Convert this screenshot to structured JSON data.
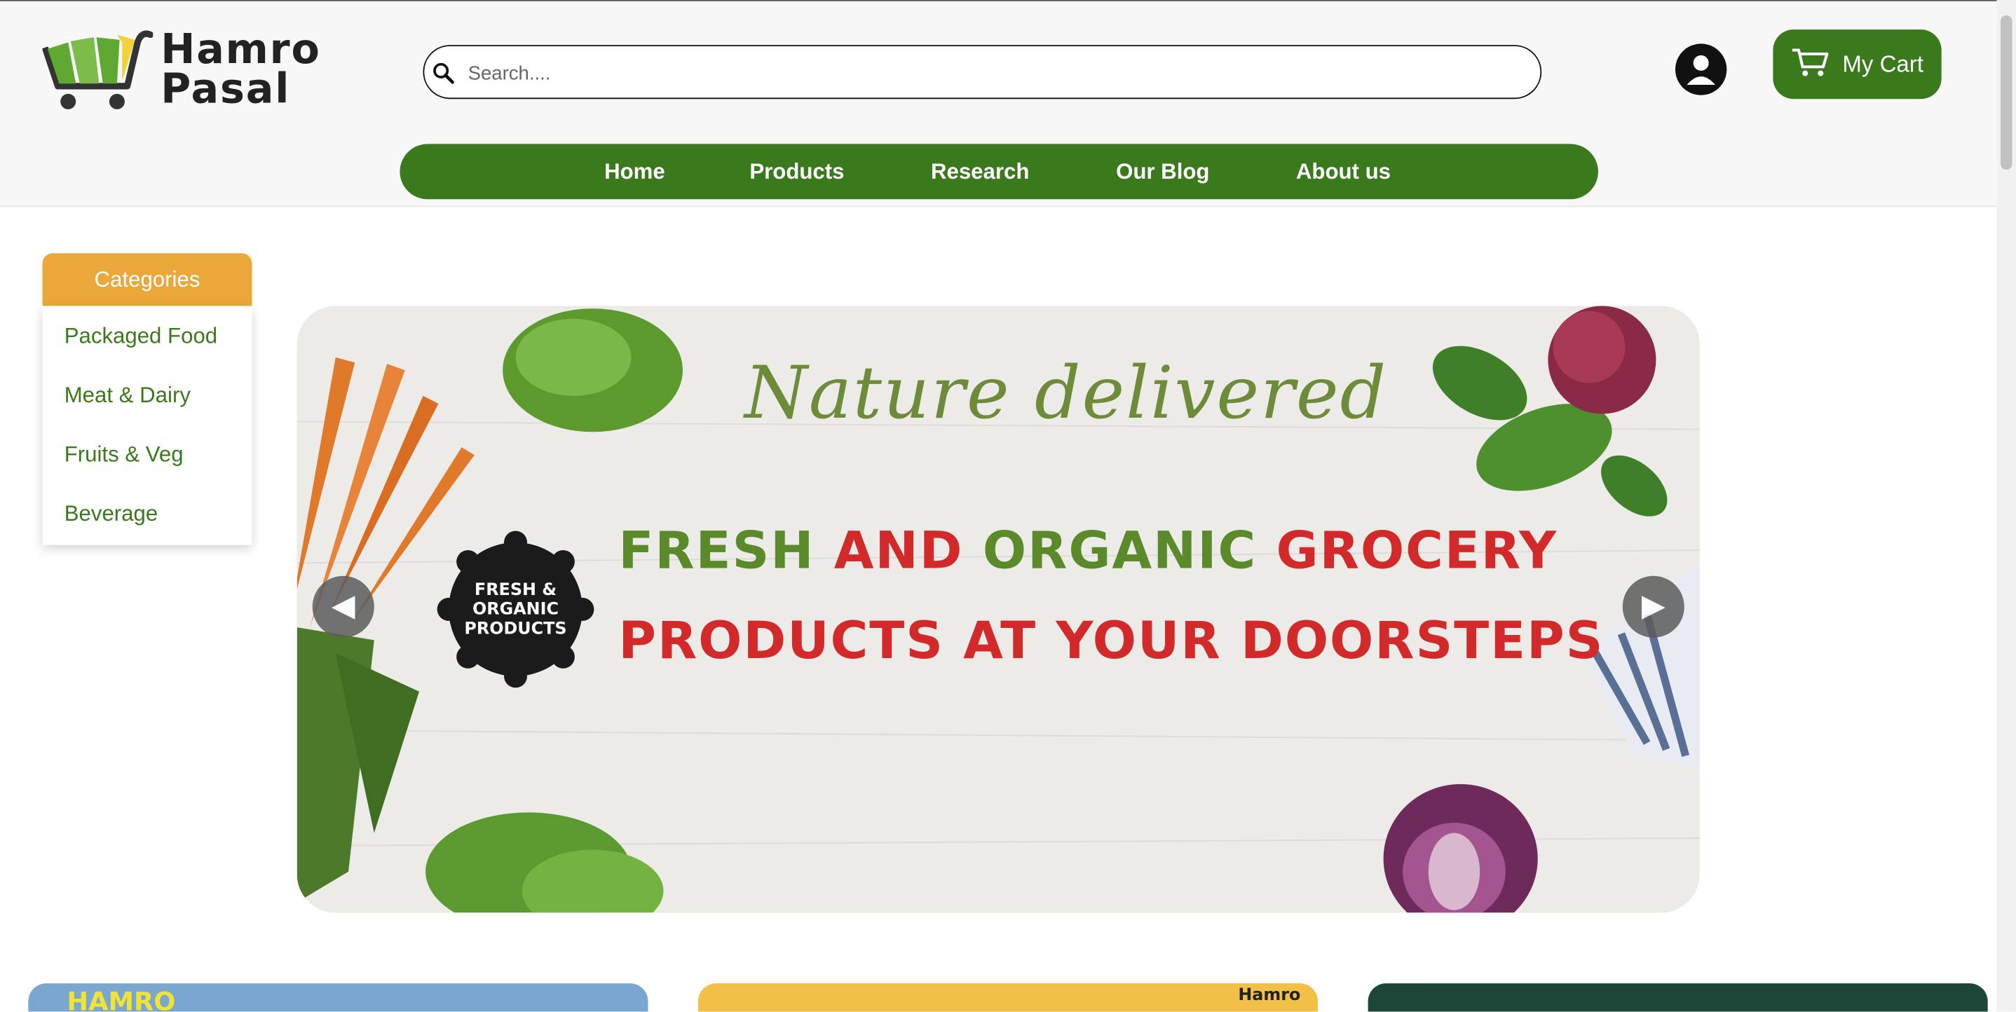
{
  "brand": {
    "name_line1": "Hamro",
    "name_line2": "Pasal",
    "primary_color": "#3b7a1c",
    "accent_color": "#eba83a"
  },
  "search": {
    "placeholder": "Search...."
  },
  "header": {
    "cart_label": "My Cart"
  },
  "nav": {
    "items": [
      "Home",
      "Products",
      "Research",
      "Our Blog",
      "About us"
    ]
  },
  "categories": {
    "button_label": "Categories",
    "items": [
      "Packaged Food",
      "Meat & Dairy",
      "Fruits & Veg",
      "Beverage"
    ]
  },
  "banner": {
    "tagline": "Nature delivered",
    "headline_line1": {
      "w1": "FRESH",
      "w2": "AND",
      "w3": "ORGANIC",
      "w4": "GROCERY"
    },
    "headline_line2": "PRODUCTS AT YOUR DOORSTEPS",
    "badge_line1": "FRESH &",
    "badge_line2": "ORGANIC",
    "badge_line3": "PRODUCTS",
    "prev_glyph": "◀",
    "next_glyph": "▶"
  },
  "promos": {
    "promo1_label": "HAMRO",
    "promo2_label": "Hamro",
    "promo3_label": ""
  },
  "icons": [
    "cart-logo-icon",
    "search-icon",
    "user-icon",
    "cart-icon",
    "arrow-left-icon",
    "arrow-right-icon"
  ]
}
